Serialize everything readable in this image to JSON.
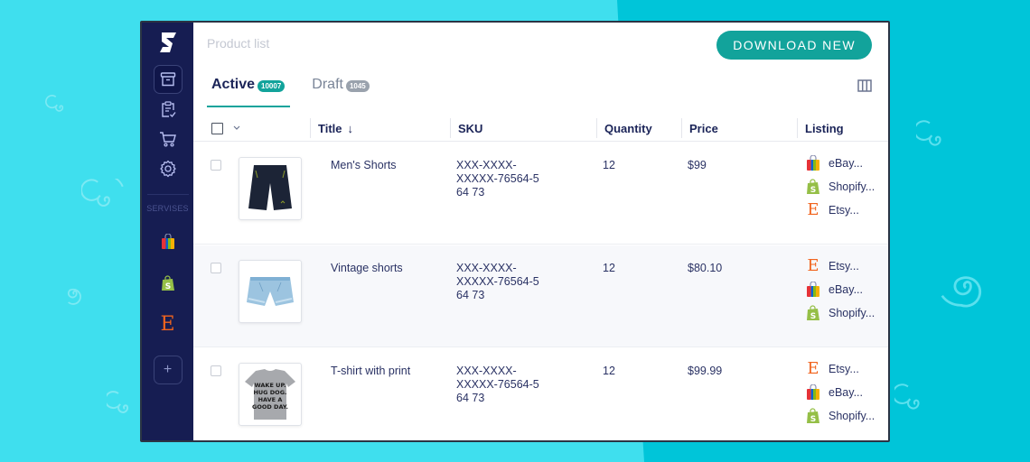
{
  "page": {
    "title": "Product list",
    "download_button": "DOWNLOAD NEW"
  },
  "sidebar": {
    "logo": "S",
    "nav_items": [
      {
        "name": "archive-icon",
        "active": true
      },
      {
        "name": "clipboard-check-icon",
        "active": false
      },
      {
        "name": "cart-icon",
        "active": false
      },
      {
        "name": "gear-icon",
        "active": false
      }
    ],
    "services_label": "SERVISES",
    "services": [
      "eBay",
      "Shopify",
      "Etsy"
    ],
    "add_label": "+"
  },
  "tabs": [
    {
      "label": "Active",
      "count": "10007",
      "active": true
    },
    {
      "label": "Draft",
      "count": "1045",
      "active": false
    }
  ],
  "table": {
    "columns": [
      "Title",
      "SKU",
      "Quantity",
      "Price",
      "Listing"
    ],
    "sort_indicator": "↓",
    "rows": [
      {
        "title": "Men's Shorts",
        "sku_lines": [
          "XXX-XXXX-",
          "XXXXX-76564-5",
          "64 73"
        ],
        "quantity": "12",
        "price": "$99",
        "image": "black-shorts",
        "listings": [
          {
            "icon": "ebay",
            "label": "eBay..."
          },
          {
            "icon": "shopify",
            "label": "Shopify..."
          },
          {
            "icon": "etsy",
            "label": "Etsy..."
          }
        ]
      },
      {
        "title": "Vintage shorts",
        "sku_lines": [
          "XXX-XXXX-",
          "XXXXX-76564-5",
          "64 73"
        ],
        "quantity": "12",
        "price": "$80.10",
        "image": "denim-shorts",
        "listings": [
          {
            "icon": "etsy",
            "label": "Etsy..."
          },
          {
            "icon": "ebay",
            "label": "eBay..."
          },
          {
            "icon": "shopify",
            "label": "Shopify..."
          }
        ]
      },
      {
        "title": "T-shirt with print",
        "sku_lines": [
          "XXX-XXXX-",
          "XXXXX-76564-5",
          "64 73"
        ],
        "quantity": "12",
        "price": "$99.99",
        "image": "gray-tshirt",
        "tshirt_print": [
          "WAKE UP.",
          "HUG DOG.",
          "HAVE A",
          "GOOD DAY."
        ],
        "listings": [
          {
            "icon": "etsy",
            "label": "Etsy..."
          },
          {
            "icon": "ebay",
            "label": "eBay..."
          },
          {
            "icon": "shopify",
            "label": "Shopify..."
          }
        ]
      }
    ]
  },
  "colors": {
    "accent": "#12a39b",
    "sidebar": "#161d52",
    "background_light": "#3fdfee",
    "background_dark": "#00c5d9",
    "etsy": "#f1641e",
    "shopify": "#95bf47"
  }
}
